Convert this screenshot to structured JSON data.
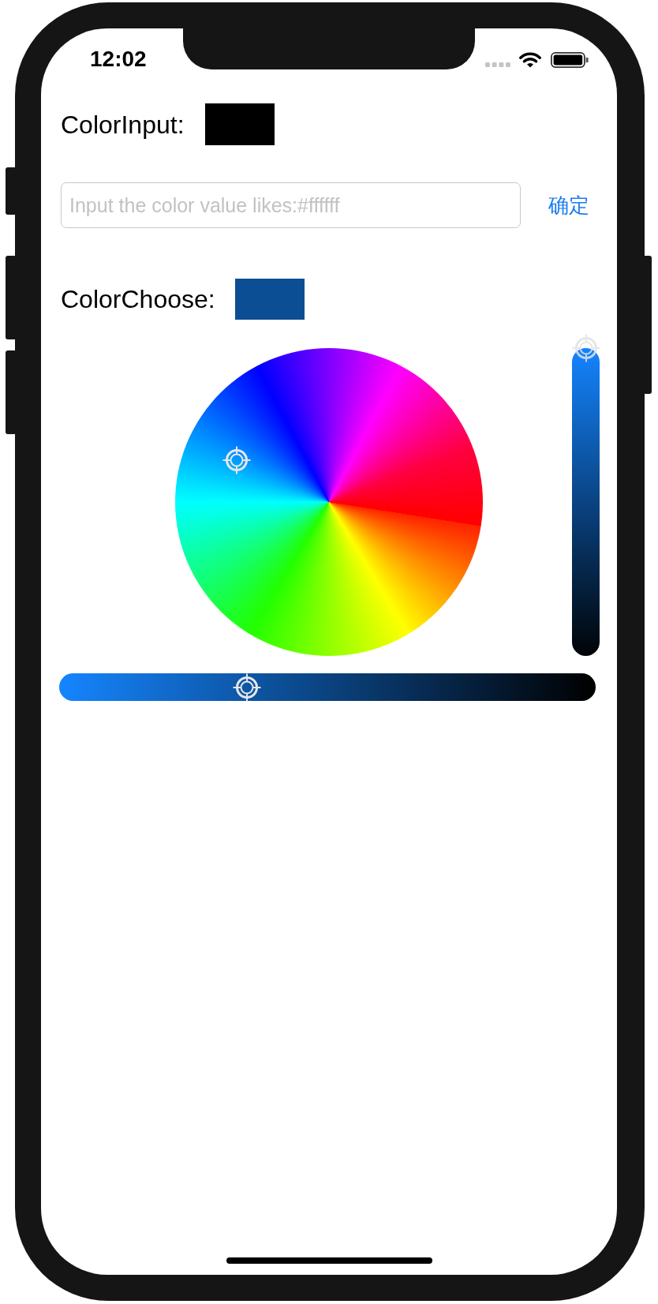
{
  "status_bar": {
    "time": "12:02"
  },
  "color_input": {
    "label": "ColorInput:",
    "color": "#000000",
    "field": {
      "placeholder": "Input the color value likes:#ffffff"
    },
    "button": "确定"
  },
  "color_choose": {
    "label": "ColorChoose:",
    "color": "#0c4e94"
  },
  "vertical_slider": {
    "level": 1
  },
  "horizontal_slider": {
    "level": 0.35
  }
}
